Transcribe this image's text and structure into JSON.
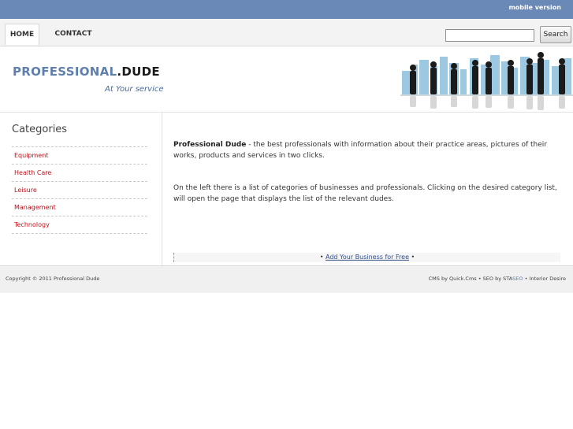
{
  "topbar": {
    "mobile_link": "mobile version"
  },
  "nav": {
    "home": "HOME",
    "contact": "CONTACT"
  },
  "search": {
    "button": "Search",
    "value": ""
  },
  "header": {
    "logo_part1": "PROFESSIONAL",
    "logo_dot": ".",
    "logo_part2": "DUDE",
    "tagline": "At Your service"
  },
  "sidebar": {
    "title": "Categories",
    "items": [
      {
        "label": "Equipment"
      },
      {
        "label": "Health Care"
      },
      {
        "label": "Leisure"
      },
      {
        "label": "Management"
      },
      {
        "label": "Technology"
      }
    ]
  },
  "main": {
    "intro_bold": "Professional Dude",
    "intro_rest": " - the best professionals with information about their practice areas, pictures of their works, products and services in two clicks.",
    "para2": "On the left there is a list of categories of businesses and professionals. Clicking on the desired category list, will open the page that displays the list of the relevant dudes.",
    "add_business": "Add Your Business for Free",
    "bullet": "•"
  },
  "footer": {
    "copyright": "Copyright © 2011 Professional Dude",
    "credits_1": "CMS by Quick.Cms • SEO by STA",
    "credits_seo": "SEO",
    "credits_2": " • Interior Desire"
  },
  "colors": {
    "topbar": "#6b89b6",
    "logo_blue": "#5f7fac",
    "category_red": "#c0101a"
  }
}
